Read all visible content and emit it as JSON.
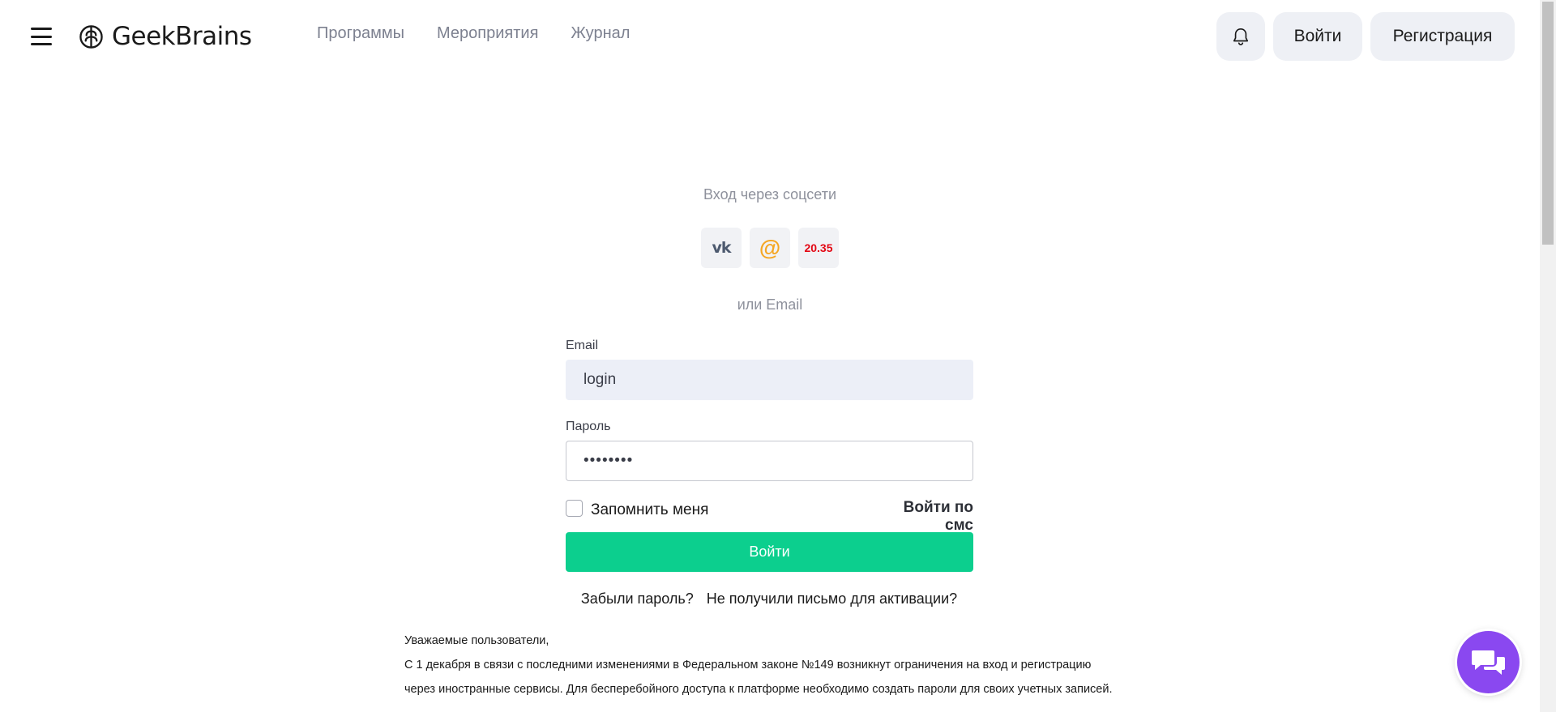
{
  "header": {
    "logo_text": "GeekBrains",
    "nav": [
      {
        "label": "Программы"
      },
      {
        "label": "Мероприятия"
      },
      {
        "label": "Журнал"
      }
    ],
    "login_label": "Войти",
    "register_label": "Регистрация"
  },
  "login": {
    "social_title": "Вход через соцсети",
    "socials": [
      {
        "name": "vk",
        "label": "vk"
      },
      {
        "name": "mail",
        "label": "@"
      },
      {
        "name": "2035",
        "label": "20.35"
      }
    ],
    "or_email": "или Email",
    "email_label": "Email",
    "email_value": "login",
    "password_label": "Пароль",
    "password_value": "••••••••",
    "remember_label": "Запомнить меня",
    "sms_label": "Войти по смс",
    "submit_label": "Войти",
    "forgot_label": "Забыли пароль?",
    "no_activation_label": "Не получили письмо для активации?"
  },
  "notice": {
    "greeting": "Уважаемые пользователи,",
    "text": "С 1 декабря в связи с последними изменениями в Федеральном законе №149 возникнут ограничения на вход и регистрацию через иностранные сервисы. Для бесперебойного доступа к платформе необходимо создать пароли для своих учетных записей."
  },
  "colors": {
    "accent_green": "#0ccf8e",
    "chat_purple": "#8a48f0",
    "nav_gray": "#7d8190",
    "button_bg": "#eef0f5"
  },
  "icons": {
    "menu": "hamburger-icon",
    "logo": "brain-logo-icon",
    "bell": "bell-icon",
    "chat": "chat-bubbles-icon"
  }
}
